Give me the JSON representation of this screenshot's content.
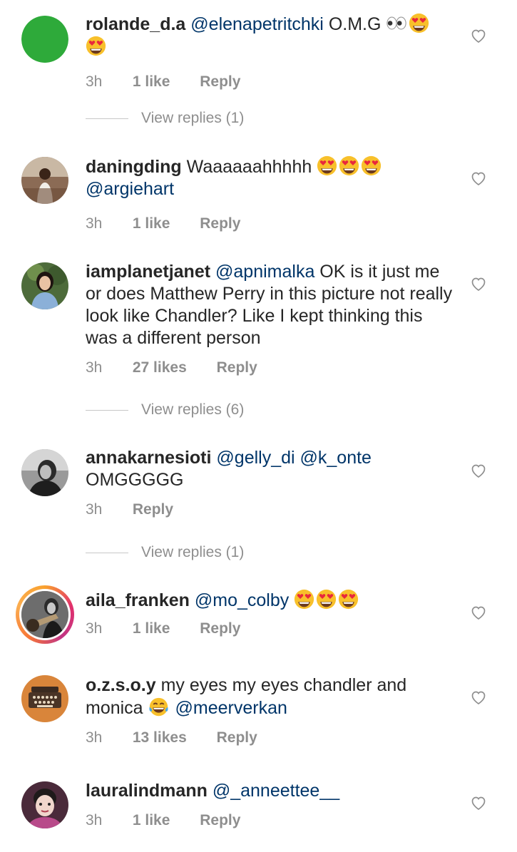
{
  "comments": [
    {
      "username": "rolande_d.a",
      "text_parts": [
        "@elenapetritchki",
        " O.M.G"
      ],
      "time": "3h",
      "likes": "1 like",
      "reply": "Reply",
      "view_replies": "View replies (1)",
      "avatar_color": "#2eaa3a"
    },
    {
      "username": "daningding",
      "text_parts": [
        " Waaaaaahhhhh",
        "@argiehart"
      ],
      "time": "3h",
      "likes": "1 like",
      "reply": "Reply"
    },
    {
      "username": "iamplanetjanet",
      "text_parts": [
        "@apnimalka",
        " OK is it just me or does Matthew Perry in this picture not really look like Chandler? Like I kept thinking this was a different person"
      ],
      "time": "3h",
      "likes": "27 likes",
      "reply": "Reply",
      "view_replies": "View replies (6)"
    },
    {
      "username": "annakarnesioti",
      "text_parts": [
        "@gelly_di",
        "@k_onte",
        "OMGGGGG"
      ],
      "time": "3h",
      "reply": "Reply",
      "view_replies": "View replies (1)"
    },
    {
      "username": "aila_franken",
      "text_parts": [
        "@mo_colby"
      ],
      "time": "3h",
      "likes": "1 like",
      "reply": "Reply"
    },
    {
      "username": "o.z.s.o.y",
      "text_parts": [
        " my eyes my eyes chandler and monica",
        "@meerverkan"
      ],
      "time": "3h",
      "likes": "13 likes",
      "reply": "Reply"
    },
    {
      "username": "lauralindmann",
      "text_parts": [
        "@_anneettee__"
      ],
      "time": "3h",
      "likes": "1 like",
      "reply": "Reply"
    }
  ],
  "colors": {
    "text": "#262626",
    "mention": "#003569",
    "meta": "#8e8e8e",
    "heart": "#8e8e8e"
  },
  "icons": [
    "heart-outline-icon",
    "eyes-emoji-icon",
    "heart-eyes-emoji-icon",
    "tears-of-joy-emoji-icon"
  ]
}
